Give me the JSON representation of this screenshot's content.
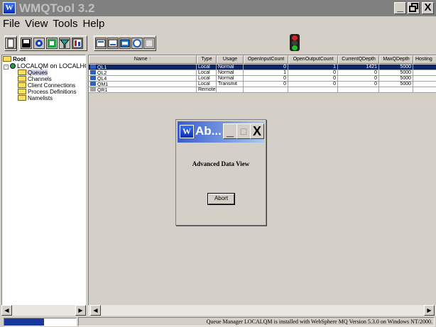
{
  "window": {
    "title": "WMQTool 3.2",
    "icon_label": "W",
    "minimize_label": "_",
    "maximize_label": "Ɖ",
    "close_label": "X"
  },
  "menu": [
    "File",
    "View",
    "Tools",
    "Help"
  ],
  "toolbar": {
    "icons": [
      "new-icon",
      "save-icon",
      "refresh-icon",
      "export-icon",
      "filter-icon",
      "report-icon",
      "large-icons-icon",
      "small-icons-icon",
      "list-view-icon",
      "detail-view-icon",
      "properties-icon"
    ],
    "status_light": "traffic-light-icon",
    "light_colors": {
      "red": "#e02020",
      "amber": "#404040",
      "green": "#20c020"
    }
  },
  "tree": {
    "root": "Root",
    "qmgr": "LOCALQM on LOCALHO",
    "children": [
      "Queues",
      "Channels",
      "Client Connections",
      "Process Definitions",
      "Namelists"
    ],
    "selected": "Queues"
  },
  "grid": {
    "columns": [
      "Name",
      "Type",
      "Usage",
      "OpenInputCount",
      "OpenOutputCount",
      "CurrentQDepth",
      "MaxQDepth",
      "Hosting"
    ],
    "sort_column": "Name",
    "sort_arrow": "↑",
    "rows": [
      {
        "name": "QL1",
        "type": "Local",
        "usage": "Normal",
        "in": "0",
        "out": "1",
        "depth": "1421",
        "max": "5000",
        "selected": true
      },
      {
        "name": "QL2",
        "type": "Local",
        "usage": "Normal",
        "in": "1",
        "out": "0",
        "depth": "0",
        "max": "5000"
      },
      {
        "name": "QL4",
        "type": "Local",
        "usage": "Normal",
        "in": "0",
        "out": "0",
        "depth": "0",
        "max": "5000"
      },
      {
        "name": "QM1",
        "type": "Local",
        "usage": "Transmit",
        "in": "0",
        "out": "0",
        "depth": "0",
        "max": "5000"
      },
      {
        "name": "QR1",
        "type": "Remote",
        "usage": "",
        "in": "",
        "out": "",
        "depth": "",
        "max": ""
      }
    ]
  },
  "scroll": {
    "left_arrow": "◀",
    "right_arrow": "▶"
  },
  "status": {
    "progress_label": "55%",
    "progress_fraction": 0.55,
    "message": "Queue Manager LOCALQM is installed with WebSphere MQ Version 5.3.0 on Windows NT/2000."
  },
  "dialog": {
    "title": "Ab...",
    "icon_label": "W",
    "minimize_label": "_",
    "maximize_label": "□",
    "close_label": "X",
    "message": "Advanced Data View",
    "abort_label": "Abort"
  }
}
